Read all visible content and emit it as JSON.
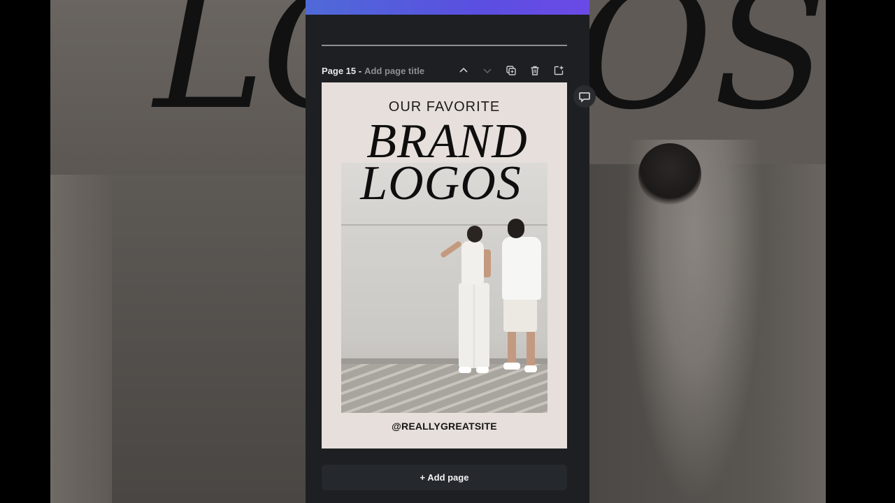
{
  "background": {
    "ghost_text_left": "LO",
    "ghost_text_right": "OS"
  },
  "page": {
    "label": "Page 15 -",
    "title_placeholder": "Add page title"
  },
  "header_icons": [
    "chevron-up-icon",
    "chevron-down-icon",
    "duplicate-icon",
    "trash-icon",
    "share-add-icon"
  ],
  "design": {
    "subheading": "OUR FAVORITE",
    "word1": "BRAND",
    "word2": "LOGOS",
    "handle": "@REALLYGREATSITE"
  },
  "add_page_label": "+ Add page",
  "colors": {
    "accent_gradient_start": "#4f6ad8",
    "accent_gradient_end": "#6b4ae6",
    "panel": "#1d1f22",
    "canvas_bg": "#e6dfdb"
  }
}
